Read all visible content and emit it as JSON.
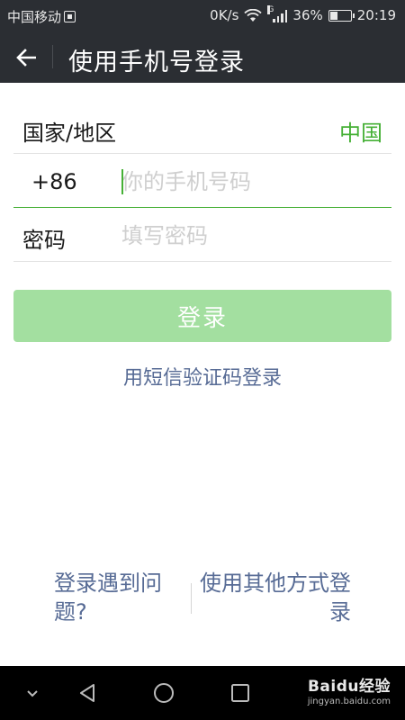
{
  "status_bar": {
    "carrier": "中国移动",
    "network_speed": "0K/s",
    "battery_percent": "36%",
    "battery_level": 0.36,
    "time": "20:19",
    "signal_type": "G",
    "icons": [
      "sim-icon",
      "wifi-icon",
      "signal-icon",
      "battery-icon"
    ]
  },
  "header": {
    "title": "使用手机号登录",
    "back_icon": "arrow-left-icon"
  },
  "form": {
    "region_label": "国家/地区",
    "region_value": "中国",
    "country_code": "+86",
    "phone_placeholder": "你的手机号码",
    "phone_value": "",
    "password_label": "密码",
    "password_placeholder": "填写密码",
    "password_value": ""
  },
  "actions": {
    "login_label": "登录",
    "sms_login_label": "用短信验证码登录"
  },
  "footer": {
    "trouble_label": "登录遇到问题?",
    "other_methods_label": "使用其他方式登录"
  },
  "nav_bar": {
    "icons": [
      "chevron-down-icon",
      "back-triangle-icon",
      "home-circle-icon",
      "recents-square-icon"
    ],
    "watermark_main": "Baidu经验",
    "watermark_sub": "jingyan.baidu.com"
  },
  "colors": {
    "accent_green": "#45b035",
    "button_disabled_green": "#a3dfa0",
    "link_blue": "#576b95",
    "header_bg": "#2b2e33"
  }
}
